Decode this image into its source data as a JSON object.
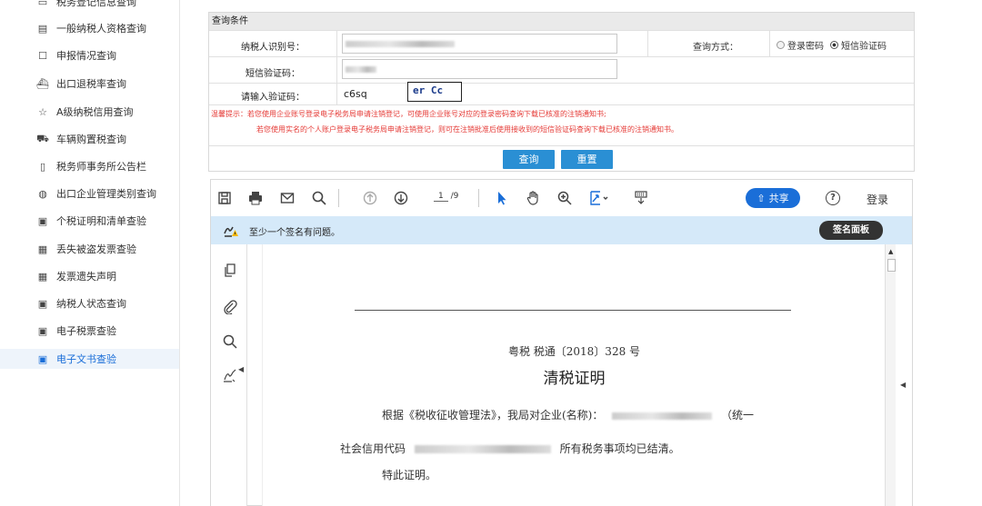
{
  "sidebar": {
    "items": [
      {
        "label": "税务登记信息查询",
        "icon": "id-card-icon"
      },
      {
        "label": "一般纳税人资格查询",
        "icon": "id-card-icon"
      },
      {
        "label": "申报情况查询",
        "icon": "document-search-icon"
      },
      {
        "label": "出口退税率查询",
        "icon": "ship-icon"
      },
      {
        "label": "A级纳税信用查询",
        "icon": "star-icon"
      },
      {
        "label": "车辆购置税查询",
        "icon": "car-icon"
      },
      {
        "label": "税务师事务所公告栏",
        "icon": "document-icon"
      },
      {
        "label": "出口企业管理类别查询",
        "icon": "globe-icon"
      },
      {
        "label": "个税证明和清单查验",
        "icon": "certificate-icon"
      },
      {
        "label": "丢失被盗发票查验",
        "icon": "invoice-icon"
      },
      {
        "label": "发票遗失声明",
        "icon": "invoice-icon"
      },
      {
        "label": "纳税人状态查询",
        "icon": "certificate-icon"
      },
      {
        "label": "电子税票查验",
        "icon": "certificate-icon"
      },
      {
        "label": "电子文书查验",
        "icon": "certificate-icon"
      }
    ],
    "active_index": 13
  },
  "query": {
    "header": "查询条件",
    "taxpayer_id_label": "纳税人识别号：",
    "sms_code_label": "短信验证码：",
    "captcha_label": "请输入验证码：",
    "captcha_value": "c6sq",
    "captcha_image_text": "er Cc",
    "method_label": "查询方式：",
    "method_options": [
      "登录密码",
      "短信验证码"
    ],
    "method_selected": "短信验证码",
    "warning_line1": "温馨提示：若您使用企业账号登录电子税务局申请注销登记，可使用企业账号对应的登录密码查询下载已核准的注销通知书;",
    "warning_line2": "若您使用实名的个人账户登录电子税务局申请注销登记，则可在注销批准后使用接收到的短信验证码查询下载已核准的注销通知书。",
    "search_button": "查询",
    "reset_button": "重置",
    "warning_color": "#e53935",
    "button_color": "#2a8fd4"
  },
  "viewer": {
    "current_page": "1",
    "total_pages": "/9",
    "share_label": "共享",
    "login_label": "登录",
    "signature_warning": "至少一个签名有问题。",
    "signature_panel": "签名面板",
    "accent_color": "#1a6ed8"
  },
  "document": {
    "reference": "粤税 税通〔2018〕328 号",
    "title": "清税证明",
    "para1_start": "根据《税收征收管理法》，我局对企业(名称)：",
    "para1_end": "（统一",
    "para2_start": "社会信用代码",
    "para2_end": "所有税务事项均已结清。",
    "para3": "特此证明。"
  }
}
